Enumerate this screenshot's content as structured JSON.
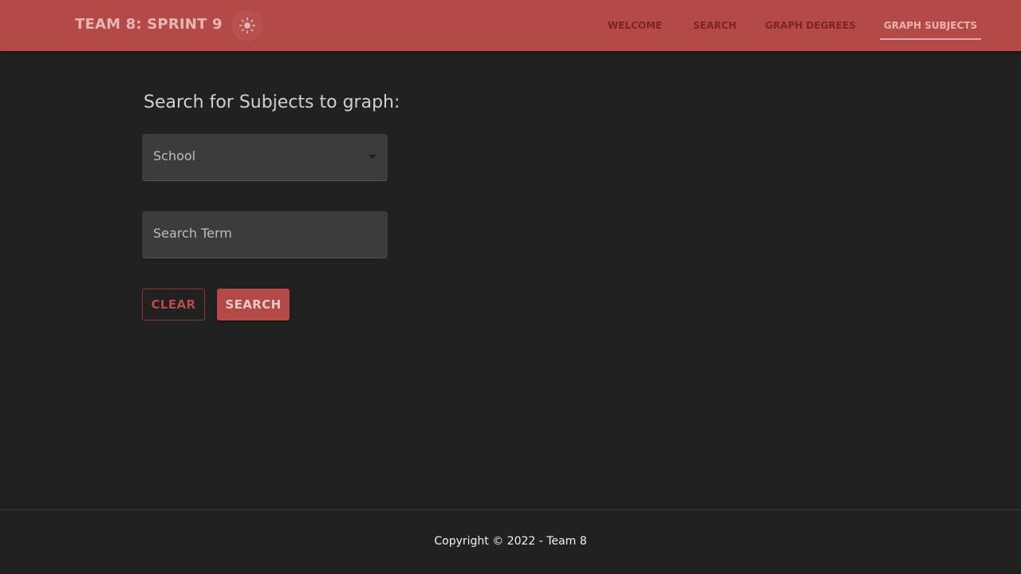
{
  "header": {
    "brand": "TEAM 8: SPRINT 9",
    "theme_toggle_icon": "sun-icon",
    "colors": {
      "bar": "#b44a47",
      "tab_inactive": "#7a2624",
      "tab_active": "#e6b3af"
    },
    "tabs": [
      {
        "label": "Welcome",
        "active": false
      },
      {
        "label": "Search",
        "active": false
      },
      {
        "label": "Graph Degrees",
        "active": false
      },
      {
        "label": "Graph Subjects",
        "active": true
      }
    ]
  },
  "main": {
    "heading": "Search for Subjects to graph:",
    "school_select": {
      "label": "School",
      "icon": "caret-down-icon"
    },
    "search_field": {
      "label": "Search Term"
    },
    "buttons": {
      "clear": "Clear",
      "search": "Search"
    }
  },
  "footer": {
    "text": "Copyright © 2022 - Team 8"
  }
}
